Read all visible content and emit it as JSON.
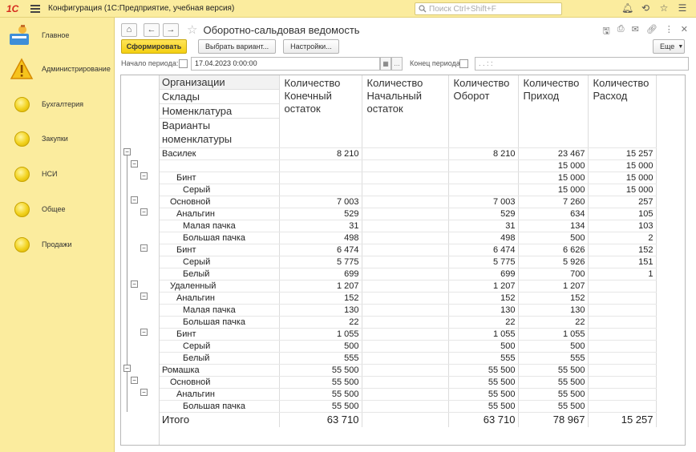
{
  "app": {
    "logo": "1С",
    "title_prefix": "Конфигурация",
    "title_suffix": "(1С:Предприятие, учебная версия)",
    "search_placeholder": "Поиск Ctrl+Shift+F"
  },
  "sidebar": {
    "items": [
      {
        "label": "Главное",
        "icon": "home-icon"
      },
      {
        "label": "Администрирование",
        "icon": "warning-icon"
      },
      {
        "label": "Бухгалтерия",
        "icon": "coin-icon"
      },
      {
        "label": "Закупки",
        "icon": "coin-icon"
      },
      {
        "label": "НСИ",
        "icon": "coin-icon"
      },
      {
        "label": "Общее",
        "icon": "coin-icon"
      },
      {
        "label": "Продажи",
        "icon": "coin-icon"
      }
    ]
  },
  "page": {
    "title": "Оборотно-сальдовая ведомость",
    "generate_label": "Сформировать",
    "variant_label": "Выбрать вариант...",
    "settings_label": "Настройки...",
    "more_label": "Еще",
    "start_label": "Начало периода:",
    "start_value": "17.04.2023  0:00:00",
    "end_label": "Конец периода:",
    "end_value": ".  .      :  :"
  },
  "report": {
    "dims": [
      "Организации",
      "Склады",
      "Номенклатура",
      "Варианты номенклатуры"
    ],
    "cols": [
      [
        "Количество",
        "Конечный",
        "остаток"
      ],
      [
        "Количество",
        "Начальный",
        "остаток"
      ],
      [
        "Количество",
        "Оборот"
      ],
      [
        "Количество",
        "Приход"
      ],
      [
        "Количество",
        "Расход"
      ]
    ],
    "rows": [
      {
        "name": "Василек",
        "indent": 0,
        "v": [
          "8 210",
          "",
          "8 210",
          "23 467",
          "15 257"
        ]
      },
      {
        "name": "",
        "indent": 1,
        "v": [
          "",
          "",
          "",
          "15 000",
          "15 000"
        ]
      },
      {
        "name": "Бинт",
        "indent": 2,
        "v": [
          "",
          "",
          "",
          "15 000",
          "15 000"
        ]
      },
      {
        "name": "Серый",
        "indent": 3,
        "v": [
          "",
          "",
          "",
          "15 000",
          "15 000"
        ]
      },
      {
        "name": "Основной",
        "indent": 1,
        "v": [
          "7 003",
          "",
          "7 003",
          "7 260",
          "257"
        ]
      },
      {
        "name": "Анальгин",
        "indent": 2,
        "v": [
          "529",
          "",
          "529",
          "634",
          "105"
        ]
      },
      {
        "name": "Малая пачка",
        "indent": 3,
        "v": [
          "31",
          "",
          "31",
          "134",
          "103"
        ]
      },
      {
        "name": "Большая пачка",
        "indent": 3,
        "v": [
          "498",
          "",
          "498",
          "500",
          "2"
        ]
      },
      {
        "name": "Бинт",
        "indent": 2,
        "v": [
          "6 474",
          "",
          "6 474",
          "6 626",
          "152"
        ]
      },
      {
        "name": "Серый",
        "indent": 3,
        "v": [
          "5 775",
          "",
          "5 775",
          "5 926",
          "151"
        ]
      },
      {
        "name": "Белый",
        "indent": 3,
        "v": [
          "699",
          "",
          "699",
          "700",
          "1"
        ]
      },
      {
        "name": "Удаленный",
        "indent": 1,
        "v": [
          "1 207",
          "",
          "1 207",
          "1 207",
          ""
        ]
      },
      {
        "name": "Анальгин",
        "indent": 2,
        "v": [
          "152",
          "",
          "152",
          "152",
          ""
        ]
      },
      {
        "name": "Малая пачка",
        "indent": 3,
        "v": [
          "130",
          "",
          "130",
          "130",
          ""
        ]
      },
      {
        "name": "Большая пачка",
        "indent": 3,
        "v": [
          "22",
          "",
          "22",
          "22",
          ""
        ]
      },
      {
        "name": "Бинт",
        "indent": 2,
        "v": [
          "1 055",
          "",
          "1 055",
          "1 055",
          ""
        ]
      },
      {
        "name": "Серый",
        "indent": 3,
        "v": [
          "500",
          "",
          "500",
          "500",
          ""
        ]
      },
      {
        "name": "Белый",
        "indent": 3,
        "v": [
          "555",
          "",
          "555",
          "555",
          ""
        ]
      },
      {
        "name": "Ромашка",
        "indent": 0,
        "v": [
          "55 500",
          "",
          "55 500",
          "55 500",
          ""
        ]
      },
      {
        "name": "Основной",
        "indent": 1,
        "v": [
          "55 500",
          "",
          "55 500",
          "55 500",
          ""
        ]
      },
      {
        "name": "Анальгин",
        "indent": 2,
        "v": [
          "55 500",
          "",
          "55 500",
          "55 500",
          ""
        ]
      },
      {
        "name": "Большая пачка",
        "indent": 3,
        "v": [
          "55 500",
          "",
          "55 500",
          "55 500",
          ""
        ]
      }
    ],
    "total": {
      "name": "Итого",
      "v": [
        "63 710",
        "",
        "63 710",
        "78 967",
        "15 257"
      ]
    }
  },
  "colors": {
    "accent": "#fbec9e",
    "button_primary": "#f4cf11"
  }
}
